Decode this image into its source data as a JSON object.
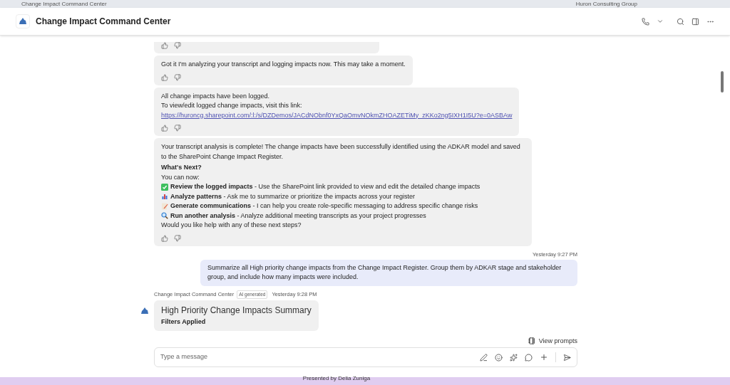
{
  "window": {
    "title": "Change Impact Command Center",
    "account": "Huron Consulting Group"
  },
  "header": {
    "title": "Change Impact Command Center"
  },
  "messages": [
    {
      "kind": "bot",
      "reactions": true
    },
    {
      "kind": "bot",
      "lines": [
        "Got it I'm analyzing your transcript and logging impacts now. This may take a moment."
      ],
      "reactions": true
    },
    {
      "kind": "bot",
      "lines": [
        "All change impacts have been logged.",
        "To view/edit logged change impacts, visit this link:"
      ],
      "link": "https://huroncg.sharepoint.com/:l:/s/DZDemos/JACdNObnf0YxQaOmvNOkmZHOAZETiMy_zKKo2ng5IXH1I5U?e=0ASBAw",
      "reactions": true
    },
    {
      "kind": "bot",
      "lines": [
        "Your transcript analysis is complete! The change impacts have been successfully identified using the ADKAR model and saved to the SharePoint Change Impact Register."
      ],
      "heading": "What's Next?",
      "intro": "You can now:",
      "items": [
        {
          "text": "**Review the logged impacts** - Use the SharePoint link provided to view and edit the detailed change impacts"
        },
        {
          "text": "**Analyze patterns** - Ask me to summarize or prioritize the impacts across your register"
        },
        {
          "text": "**Generate communications** - I can help you create role-specific messaging to address specific change risks"
        },
        {
          "text": "**Run another analysis** - Analyze additional meeting transcripts as your project progresses"
        }
      ],
      "outro": "Would you like help with any of these next steps?",
      "reactions": true
    },
    {
      "kind": "user",
      "time": "Yesterday 9:27 PM",
      "lines": [
        "Summarize all High priority change impacts from the Change Impact Register. Group them by ADKAR stage and stakeholder group, and include how many impacts were included."
      ]
    },
    {
      "kind": "bot",
      "sender": "Change Impact Command Center",
      "badge": "AI generated",
      "time": "Yesterday 9:28 PM",
      "title": "High Priority Change Impacts Summary",
      "heading": "Filters Applied",
      "reactions": false
    }
  ],
  "view_prompts": "View prompts",
  "composer": {
    "placeholder": "Type a message"
  },
  "footer": "Presented by Delia Zuniga"
}
